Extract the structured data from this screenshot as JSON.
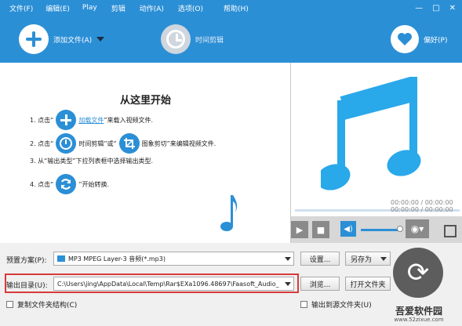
{
  "menu": [
    "文件(F)",
    "编辑(E)",
    "Play",
    "剪辑",
    "动作(A)",
    "选项(O)",
    "帮助(H)"
  ],
  "window_controls": [
    "—",
    "□",
    "✕"
  ],
  "toolbar": {
    "add_file_label": "添加文件(A)",
    "time_trim_label": "时间剪辑",
    "preferences_label": "偏好(P)"
  },
  "start": {
    "title": "从这里开始",
    "step1_prefix": "1.  点击“",
    "step1_link": "加载文件",
    "step1_suffix": "”来载入视频文件.",
    "step2_prefix": "2.  点击“",
    "step2_mid1": "时间剪辑”或“",
    "step2_mid2": "图象剪切”来编辑视频文件.",
    "step3": "3.  从“输出类型”下拉列表框中选择输出类型.",
    "step4_prefix": "4.  点击“",
    "step4_suffix": "”开始转换."
  },
  "player": {
    "time_total": "00:00:00 / 00:00:00",
    "time_current": "00:00:00 / 00:00:00"
  },
  "preset": {
    "label": "预置方案(P):",
    "value": "MP3 MPEG Layer-3 音频(*.mp3)",
    "settings_button": "设置...",
    "save_as_button": "另存为"
  },
  "output": {
    "label": "输出目录(U):",
    "value": "C:\\Users\\jing\\AppData\\Local\\Temp\\Rar$EXa1096.48697\\Faasoft_Audio_",
    "browse_button": "浏览...",
    "open_folder_button": "打开文件夹"
  },
  "options": {
    "copy_structure": "复制文件夹结构(C)",
    "output_to_source": "输出到源文件夹(U)"
  },
  "watermark": {
    "name": "吾爱软件园",
    "url": "www.52zixue.com"
  },
  "colors": {
    "accent": "#2b8fd6",
    "highlight_frame": "#d83a3a"
  }
}
